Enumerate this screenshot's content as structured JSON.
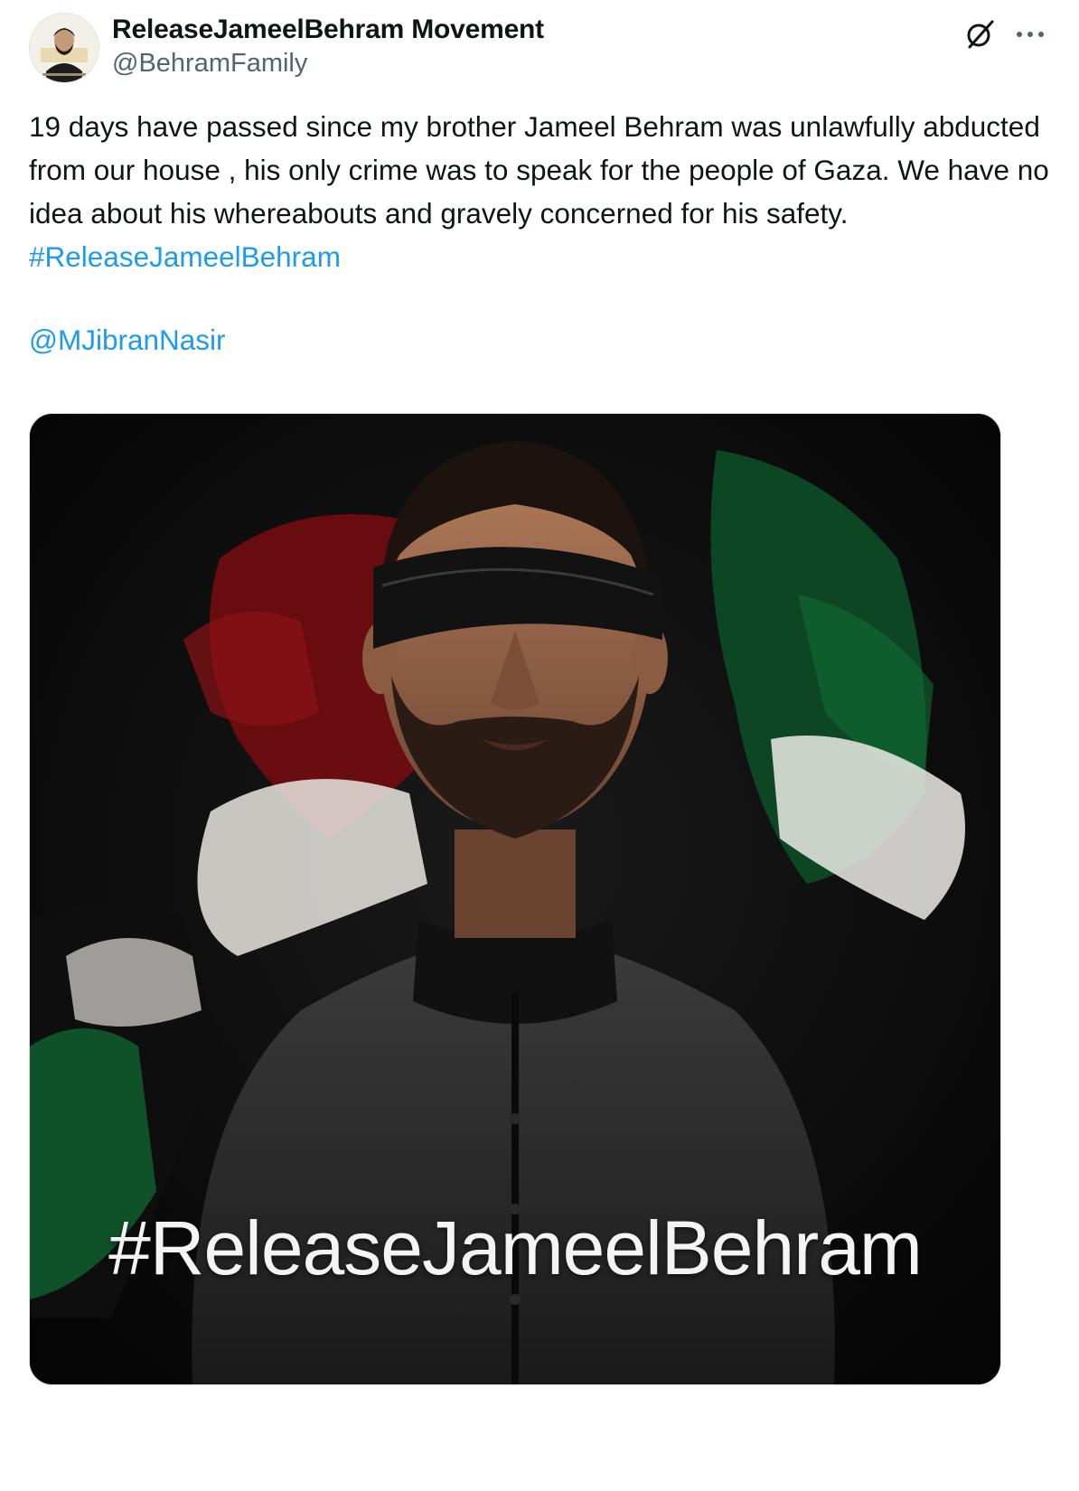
{
  "author": {
    "display_name": "ReleaseJameelBehram Movement",
    "handle": "@BehramFamily",
    "avatar_icon": "profile-portrait-avatar"
  },
  "header_icons": {
    "grok": "grok-icon",
    "more": "more-options-icon"
  },
  "tweet": {
    "body": "19 days have passed since my brother Jameel Behram was unlawfully abducted from our house , his only crime was to speak for the people of Gaza. We have no idea about his whereabouts and gravely concerned for his safety.",
    "hashtag": "#ReleaseJameelBehram",
    "mention": "@MJibranNasir"
  },
  "media": {
    "overlay_text": "#ReleaseJameelBehram"
  },
  "colors": {
    "link": "#1d9bf0",
    "text": "#0f1419",
    "secondary": "#536471",
    "border": "#cfd9de",
    "flag_red": "#7a0f12",
    "flag_green": "#0f5a2c"
  }
}
